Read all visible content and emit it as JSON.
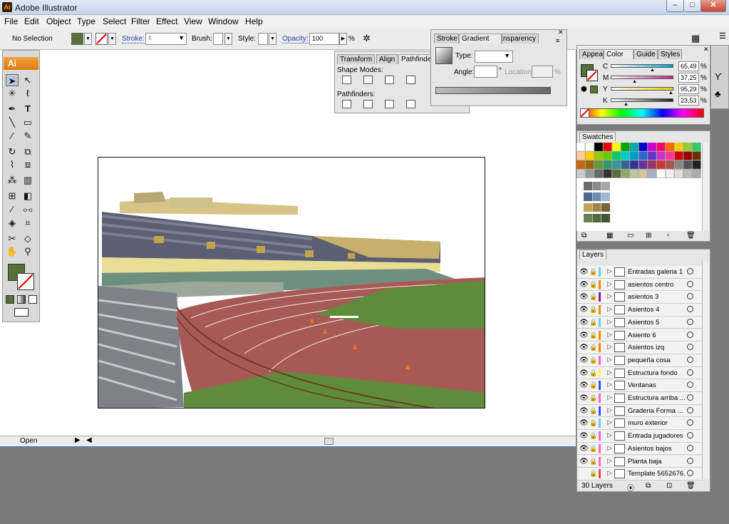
{
  "window": {
    "title": "Adobe Illustrator",
    "app_icon": "Ai"
  },
  "menu": [
    "File",
    "Edit",
    "Object",
    "Type",
    "Select",
    "Filter",
    "Effect",
    "View",
    "Window",
    "Help"
  ],
  "control_bar": {
    "selection_state": "No Selection",
    "fill_color": "#577139",
    "stroke_label": "Stroke:",
    "brush_label": "Brush:",
    "style_label": "Style:",
    "opacity_label": "Opacity:",
    "opacity_value": "100",
    "opacity_unit": "%"
  },
  "tools": {
    "badge": "Ai",
    "fill_color": "#577139"
  },
  "align_panel": {
    "tabs": [
      "Transform",
      "Align",
      "Pathfinder"
    ],
    "shape_modes_label": "Shape Modes:",
    "pathfinders_label": "Pathfinders:"
  },
  "gradient_panel": {
    "tabs": [
      "Stroke",
      "Gradient",
      "Transparency"
    ],
    "type_label": "Type:",
    "angle_label": "Angle:",
    "angle_unit": "°",
    "location_label": "Location:",
    "location_unit": "%"
  },
  "color_panel": {
    "tabs": [
      "Appearance",
      "Color",
      "Guide",
      "Styles"
    ],
    "fill_color": "#577139",
    "channels": [
      {
        "name": "C",
        "value": "65,49",
        "unit": "%",
        "color": "#00a0c6",
        "level": 0.6549
      },
      {
        "name": "M",
        "value": "37,25",
        "unit": "%",
        "color": "#c8288c",
        "level": 0.3725
      },
      {
        "name": "Y",
        "value": "95,29",
        "unit": "%",
        "color": "#e8d000",
        "level": 0.9529
      },
      {
        "name": "K",
        "value": "23,53",
        "unit": "%",
        "color": "#222222",
        "level": 0.2353
      }
    ]
  },
  "swatches_panel": {
    "title": "Swatches"
  },
  "layers_panel": {
    "title": "Layers",
    "count_label": "30 Layers",
    "layers": [
      {
        "name": "Entradas galeria 1",
        "color": "#66ccff",
        "visible": true
      },
      {
        "name": "asientos centro",
        "color": "#ff8800",
        "visible": true
      },
      {
        "name": "asientos 3",
        "color": "#7a1fa0",
        "visible": true
      },
      {
        "name": "Asientos 4",
        "color": "#ff8800",
        "visible": true
      },
      {
        "name": "Asientos 5",
        "color": "#66ccff",
        "visible": true
      },
      {
        "name": "Asiento 6",
        "color": "#ff8800",
        "visible": true
      },
      {
        "name": "Asientos izq",
        "color": "#ff8800",
        "visible": true
      },
      {
        "name": "pequeña cosa",
        "color": "#ff66cc",
        "visible": true
      },
      {
        "name": "Estructura fondo",
        "color": "#ffee55",
        "visible": true
      },
      {
        "name": "Ventanas",
        "color": "#3355ff",
        "visible": true
      },
      {
        "name": "Estructura arriba ...",
        "color": "#ff66cc",
        "visible": true
      },
      {
        "name": "Graderia Forma ...",
        "color": "#3355ff",
        "visible": true
      },
      {
        "name": "muro exterior",
        "color": "#66ccff",
        "visible": true
      },
      {
        "name": "Entrada jugadores",
        "color": "#ff66cc",
        "visible": true
      },
      {
        "name": "Asientos bajos",
        "color": "#ff66cc",
        "visible": true
      },
      {
        "name": "Planta baja",
        "color": "#ff66cc",
        "visible": true
      },
      {
        "name": "Template 5652676...",
        "color": "#ff4444",
        "visible": false
      }
    ]
  },
  "status_bar": {
    "mode": "Open"
  }
}
